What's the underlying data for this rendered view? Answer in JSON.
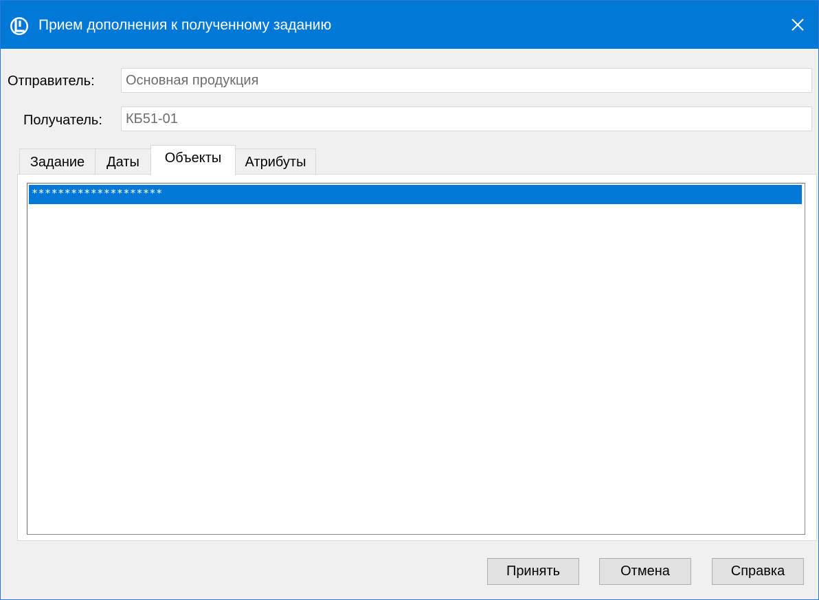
{
  "window": {
    "title": "Прием дополнения к полученному заданию",
    "close_glyph": "✕"
  },
  "fields": {
    "sender_label": "Отправитель:",
    "sender_value": "Основная продукция",
    "recipient_label": "Получатель:",
    "recipient_value": "КБ51-01"
  },
  "tabs": [
    {
      "label": "Задание",
      "active": false
    },
    {
      "label": "Даты",
      "active": false
    },
    {
      "label": "Объекты",
      "active": true
    },
    {
      "label": "Атрибуты",
      "active": false
    }
  ],
  "objects_list": {
    "items": [
      {
        "text": "********************",
        "selected": true
      }
    ]
  },
  "buttons": {
    "accept": "Принять",
    "cancel": "Отмена",
    "help": "Справка"
  },
  "colors": {
    "titlebar": "#0078d7",
    "selection": "#0078d7",
    "window_bg": "#f0f0f0"
  },
  "icons": {
    "app": "app-logo-icon",
    "close": "close-icon"
  }
}
